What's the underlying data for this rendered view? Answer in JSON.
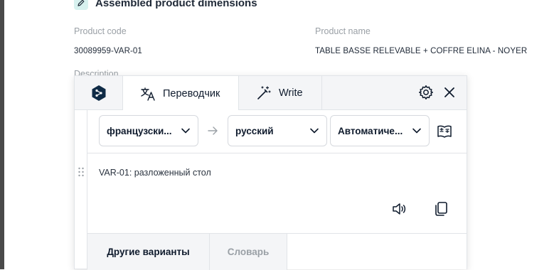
{
  "section": {
    "icon": "pencil-icon",
    "title": "Assembled product dimensions"
  },
  "fields": {
    "product_code_label": "Product code",
    "product_code_value": "30089959-VAR-01",
    "product_name_label": "Product name",
    "product_name_value": "TABLE BASSE RELEVABLE + COFFRE ELINA - NOYER",
    "description_label": "Description"
  },
  "translator": {
    "tabs": [
      {
        "label": "Переводчик",
        "icon": "translate-icon",
        "active": true
      },
      {
        "label": "Write",
        "icon": "magic-wand-icon",
        "active": false
      }
    ],
    "source_language": "французски...",
    "target_language": "русский",
    "mode": "Автоматиче...",
    "result_text": "VAR-01: разложенный стол",
    "footer_tabs": {
      "alternatives": "Другие варианты",
      "dictionary": "Словарь"
    },
    "colors": {
      "accent": "#0f2b46",
      "text": "#0f1b2d",
      "muted": "#9aa0a6",
      "border": "#e1e4e8"
    }
  }
}
